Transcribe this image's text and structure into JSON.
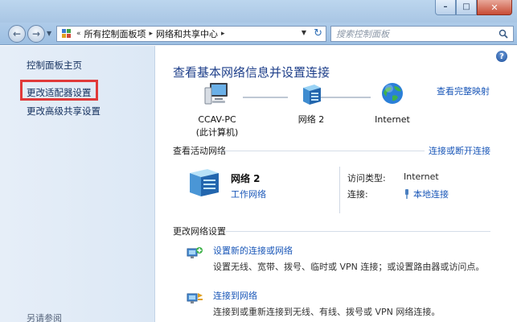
{
  "window": {
    "minimize_glyph": "–",
    "maximize_glyph": "□",
    "close_glyph": "✕"
  },
  "address": {
    "prefix": "«",
    "crumbs": [
      "所有控制面板项",
      "网络和共享中心"
    ],
    "separator": "▸",
    "icon": "control-panel-icon"
  },
  "search": {
    "placeholder": "搜索控制面板"
  },
  "sidebar": {
    "items": [
      {
        "label": "控制面板主页"
      },
      {
        "label": "更改适配器设置"
      },
      {
        "label": "更改高级共享设置"
      }
    ],
    "see_also": "另请参阅"
  },
  "main": {
    "title": "查看基本网络信息并设置连接",
    "map_link": "查看完整映射",
    "nodes": [
      {
        "name": "CCAV-PC",
        "sub": "(此计算机)",
        "icon": "computer-icon"
      },
      {
        "name": "网络 2",
        "icon": "network-icon"
      },
      {
        "name": "Internet",
        "icon": "globe-icon"
      }
    ],
    "active_section": {
      "title": "查看活动网络",
      "link": "连接或断开连接",
      "network_name": "网络 2",
      "network_type": "工作网络",
      "access_type_label": "访问类型:",
      "access_type_value": "Internet",
      "connection_label": "连接:",
      "connection_value": "本地连接"
    },
    "change_section": {
      "title": "更改网络设置",
      "tasks": [
        {
          "title": "设置新的连接或网络",
          "desc": "设置无线、宽带、拨号、临时或 VPN 连接；或设置路由器或访问点。"
        },
        {
          "title": "连接到网络",
          "desc": "连接到或重新连接到无线、有线、拨号或 VPN 网络连接。"
        }
      ]
    },
    "help_glyph": "?"
  },
  "colors": {
    "link": "#1a57b8",
    "title": "#1e3f8a",
    "highlight": "#e03a3a"
  }
}
